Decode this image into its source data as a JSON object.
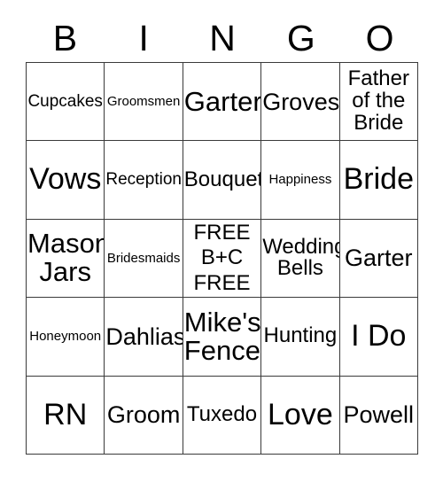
{
  "header": {
    "letters": [
      "B",
      "I",
      "N",
      "G",
      "O"
    ]
  },
  "grid": {
    "rows": [
      [
        {
          "text": "Cupcakes",
          "size": "s-sm"
        },
        {
          "text": "Groomsmen",
          "size": "s-xs"
        },
        {
          "text": "Garter",
          "size": "s-xl"
        },
        {
          "text": "Groves",
          "size": "s-lg"
        },
        {
          "text": "Father\nof the\nBride",
          "size": "s-md"
        }
      ],
      [
        {
          "text": "Vows",
          "size": "s-xxl"
        },
        {
          "text": "Reception",
          "size": "s-sm"
        },
        {
          "text": "Bouquet",
          "size": "s-md"
        },
        {
          "text": "Happiness",
          "size": "s-xs"
        },
        {
          "text": "Bride",
          "size": "s-xxl"
        }
      ],
      [
        {
          "text": "Mason\nJars",
          "size": "s-xl"
        },
        {
          "text": "Bridesmaids",
          "size": "s-xs"
        },
        {
          "text": "FREE\nB+C\nFREE",
          "size": "s-md",
          "free": true
        },
        {
          "text": "Wedding\nBells",
          "size": "s-md"
        },
        {
          "text": "Garter",
          "size": "s-lg"
        }
      ],
      [
        {
          "text": "Honeymoon",
          "size": "s-xs"
        },
        {
          "text": "Dahlias",
          "size": "s-lg"
        },
        {
          "text": "Mike's\nFence",
          "size": "s-xl"
        },
        {
          "text": "Hunting",
          "size": "s-md"
        },
        {
          "text": "I Do",
          "size": "s-xxl"
        }
      ],
      [
        {
          "text": "RN",
          "size": "s-xxl"
        },
        {
          "text": "Groom",
          "size": "s-lg"
        },
        {
          "text": "Tuxedo",
          "size": "s-md"
        },
        {
          "text": "Love",
          "size": "s-xxl"
        },
        {
          "text": "Powell",
          "size": "s-lg"
        }
      ]
    ]
  },
  "style": {
    "border_color": "#3a3a3a",
    "text_color": "#000000",
    "background": "#ffffff"
  }
}
